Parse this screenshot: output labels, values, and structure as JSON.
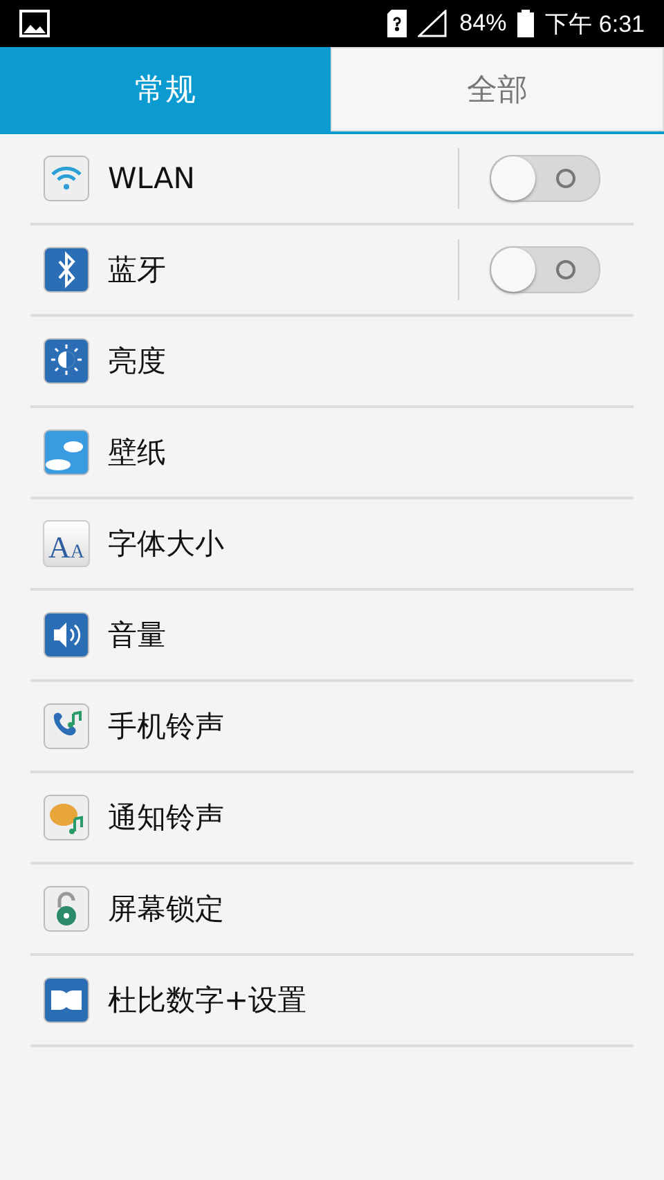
{
  "status_bar": {
    "battery": "84%",
    "time": "下午 6:31"
  },
  "tabs": [
    {
      "label": "常规",
      "selected": true
    },
    {
      "label": "全部",
      "selected": false
    }
  ],
  "items": [
    {
      "kind": "toggle",
      "label": "WLAN",
      "on": false
    },
    {
      "kind": "toggle",
      "label": "蓝牙",
      "on": false
    },
    {
      "kind": "link",
      "label": "亮度"
    },
    {
      "kind": "link",
      "label": "壁纸"
    },
    {
      "kind": "link",
      "label": "字体大小",
      "icon_text": "AA"
    },
    {
      "kind": "link",
      "label": "音量"
    },
    {
      "kind": "link",
      "label": "手机铃声"
    },
    {
      "kind": "link",
      "label": "通知铃声"
    },
    {
      "kind": "link",
      "label": "屏幕锁定"
    },
    {
      "kind": "link",
      "label": "杜比数字+设置"
    }
  ]
}
